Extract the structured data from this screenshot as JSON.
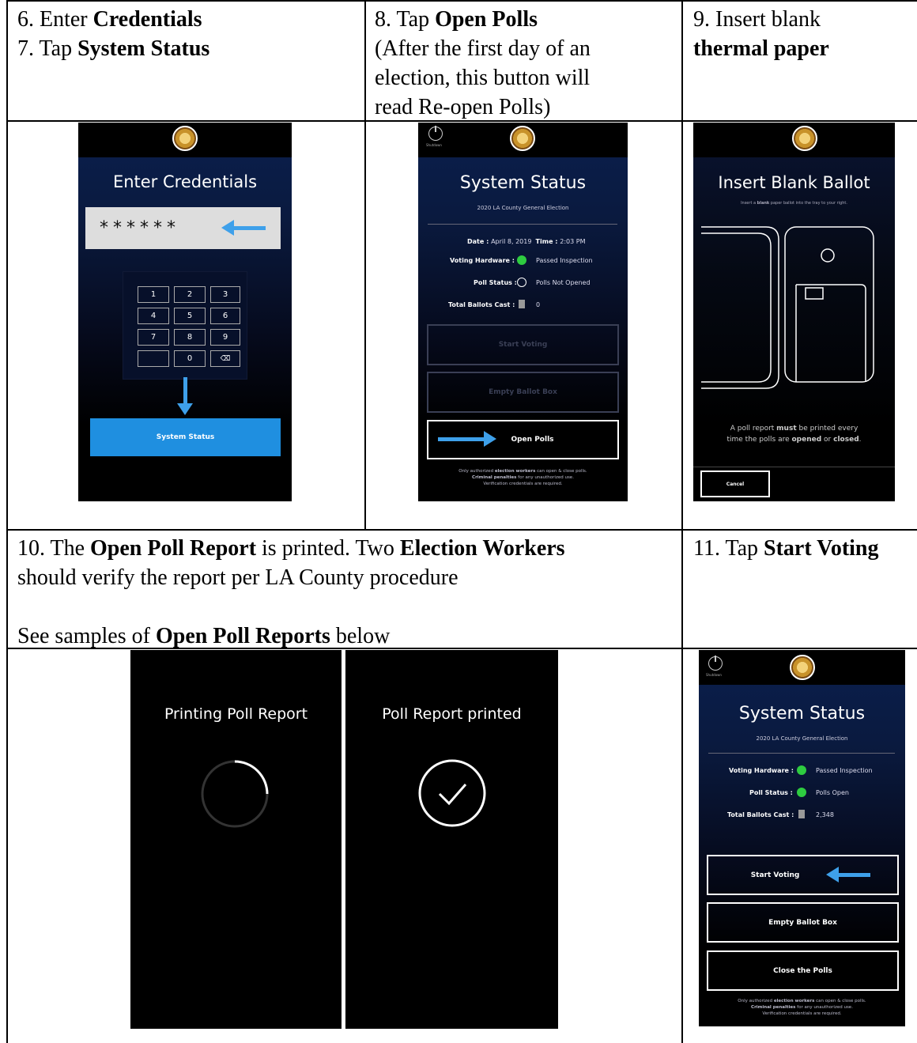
{
  "cells": {
    "c6": {
      "n1": "6. Enter ",
      "b1": "Credentials",
      "n2": "7. Tap ",
      "b2": "System Status"
    },
    "c8": {
      "n1": "8. Tap ",
      "b1": "Open Polls",
      "l2": "(After the first day of an",
      "l3": "election, this button will",
      "l4": "read Re-open Polls)"
    },
    "c9": {
      "n1": "9. Insert blank",
      "b1": "thermal paper"
    },
    "c10": {
      "n1": "10. The ",
      "b1": "Open Poll Report",
      "n2": " is printed. Two ",
      "b2": "Election Workers",
      "l2": "should verify the report per LA County procedure",
      "n3": "See samples of ",
      "b3": "Open Poll Reports",
      "n4": " below"
    },
    "c11": {
      "n1": "11. Tap ",
      "b1": "Start Voting"
    }
  },
  "screen_credentials": {
    "title": "Enter Credentials",
    "password": "******",
    "keys": [
      "1",
      "2",
      "3",
      "4",
      "5",
      "6",
      "7",
      "8",
      "9",
      "",
      "0",
      "⌫"
    ],
    "button": "System Status"
  },
  "screen_status1": {
    "power_label": "Shutdown",
    "title": "System Status",
    "subtitle": "2020 LA County General Election",
    "date_label": "Date : ",
    "date": "April 8, 2019",
    "time_label": "Time : ",
    "time": "2:03 PM",
    "hw_label": "Voting Hardware :",
    "hw_value": "Passed Inspection",
    "poll_label": "Poll Status :",
    "poll_value": "Polls Not Opened",
    "ballots_label": "Total Ballots Cast :",
    "ballots_value": "0",
    "btn1": "Start Voting",
    "btn2": "Empty Ballot Box",
    "btn3": "Open Polls",
    "foot1a": "Only authorized ",
    "foot1b": "election workers",
    "foot1c": " can open & close polls.",
    "foot2a": "Criminal penalties",
    "foot2b": " for any unauthorized use.",
    "foot3": "Verification credentials are required."
  },
  "screen_insert": {
    "title": "Insert Blank Ballot",
    "subtitle_a": "Insert a ",
    "subtitle_b": "blank",
    "subtitle_c": " paper ballot into the tray to your right.",
    "note1a": "A poll report ",
    "note1b": "must",
    "note1c": " be printed every",
    "note2a": "time the polls are ",
    "note2b": "opened",
    "note2c": " or ",
    "note2d": "closed",
    "note2e": ".",
    "cancel": "Cancel"
  },
  "screen_printing": {
    "title": "Printing Poll Report"
  },
  "screen_printed": {
    "title": "Poll Report printed"
  },
  "screen_status2": {
    "power_label": "Shutdown",
    "title": "System Status",
    "subtitle": "2020 LA County General Election",
    "hw_label": "Voting Hardware :",
    "hw_value": "Passed Inspection",
    "poll_label": "Poll Status :",
    "poll_value": "Polls Open",
    "ballots_label": "Total Ballots Cast :",
    "ballots_value": "2,348",
    "btn1": "Start Voting",
    "btn2": "Empty Ballot Box",
    "btn3": "Close the Polls",
    "foot1a": "Only authorized ",
    "foot1b": "election workers",
    "foot1c": " can open & close polls.",
    "foot2a": "Criminal penalties",
    "foot2b": " for any unauthorized use.",
    "foot3": "Verification credentials are required."
  },
  "colors": {
    "accent_blue": "#3ea0ea",
    "status_green": "#2ecc40"
  }
}
